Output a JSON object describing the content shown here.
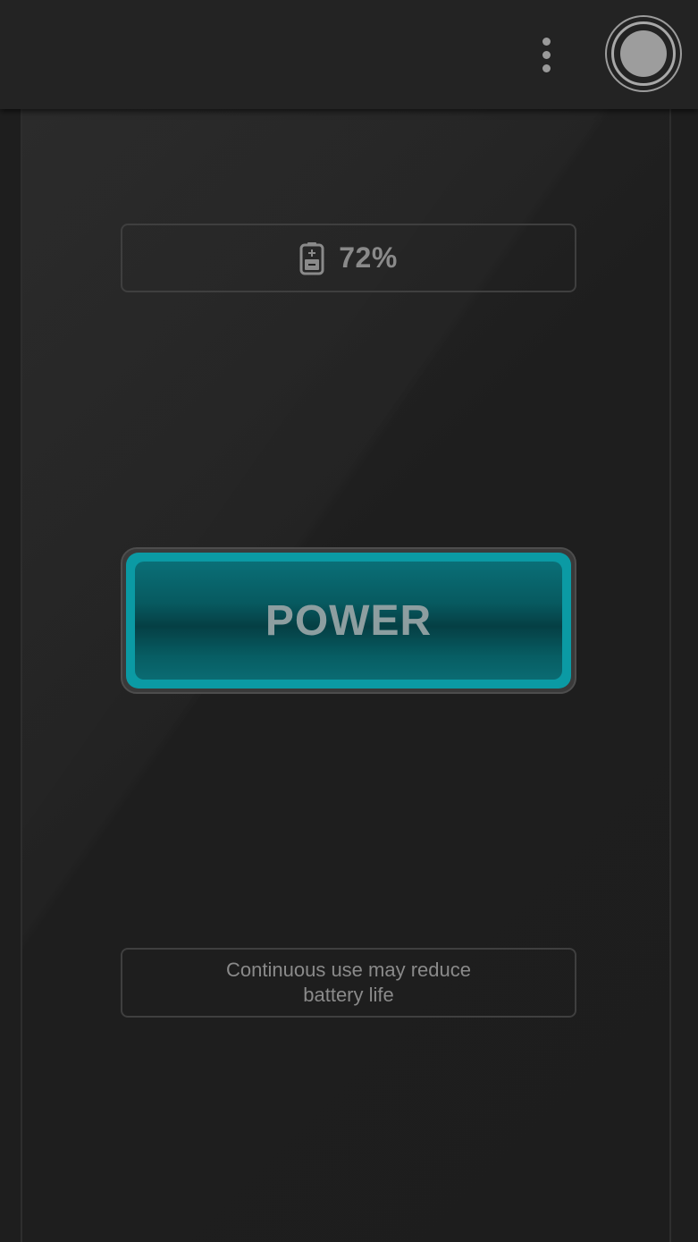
{
  "topbar": {
    "menu_icon": "overflow-menu-icon",
    "profile_icon": "circle-toggle-icon"
  },
  "battery": {
    "icon": "battery-icon",
    "level_text": "72%"
  },
  "power_button": {
    "label": "POWER"
  },
  "warning": {
    "text": "Continuous use may reduce battery life"
  },
  "colors": {
    "background": "#1e1e1e",
    "topbar": "#232323",
    "accent": "#0b9aa4",
    "text_muted": "#8a8a8a"
  }
}
